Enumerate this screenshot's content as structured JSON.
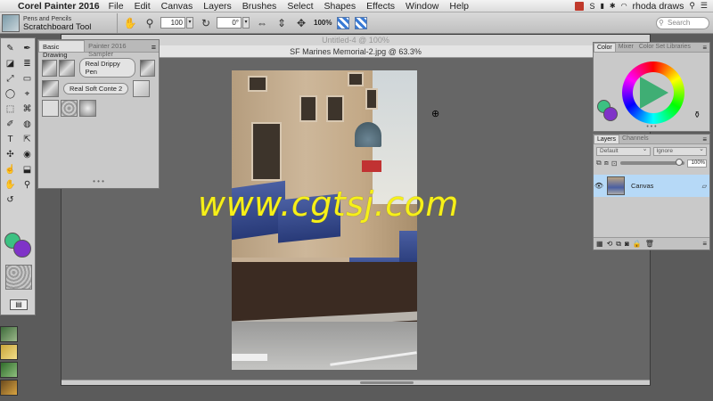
{
  "menubar": {
    "apple": "",
    "app_name": "Corel Painter 2016",
    "items": [
      "File",
      "Edit",
      "Canvas",
      "Layers",
      "Brushes",
      "Select",
      "Shapes",
      "Effects",
      "Window",
      "Help"
    ],
    "user": "rhoda draws"
  },
  "property_bar": {
    "brush_category": "Pens and Pencils",
    "brush_variant": "Scratchboard Tool",
    "zoom_value": "100",
    "rotation_value": "0°",
    "reset_label": "100%",
    "search_placeholder": "Search"
  },
  "document": {
    "title_back": "Untitled-4 @ 100%",
    "title_front": "SF Marines Memorial-2.jpg @ 63.3%"
  },
  "watermark": "www.cgtsj.com",
  "brush_library": {
    "tabs": [
      "Basic Drawing",
      "Painter 2016 Sampler"
    ],
    "brush_1": "Real Drippy Pen",
    "brush_2": "Real Soft Conte 2",
    "dots": "• • •"
  },
  "color_panel": {
    "tabs": [
      "Color",
      "Mixer",
      "Color Set Libraries"
    ],
    "dots": "• • •"
  },
  "layers_panel": {
    "tabs": [
      "Layers",
      "Channels"
    ],
    "composite_method": "Default",
    "composite_depth": "Ignore",
    "opacity": "100%",
    "layer_name": "Canvas"
  },
  "toolbox": {
    "tools": [
      "✎",
      "✒",
      "◪",
      "≣",
      "⤢",
      "▭",
      "◯",
      "⌖",
      "⬚",
      "⌘",
      "✐",
      "◍",
      "T",
      "⇱",
      "✣",
      "◉",
      "☝",
      "⬓",
      "✋",
      "⚲",
      "↺"
    ],
    "layout_label": "▤"
  },
  "colors": {
    "main": "#3cc182",
    "additional": "#7f33c8"
  }
}
